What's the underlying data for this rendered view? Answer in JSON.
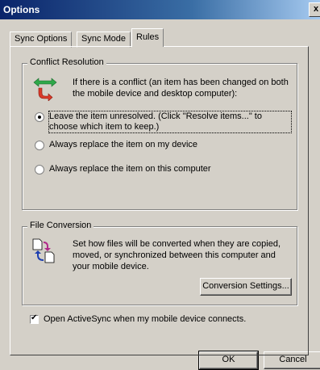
{
  "window": {
    "title": "Options",
    "close_glyph": "x"
  },
  "tabs": [
    {
      "label": "Sync Options",
      "active": false
    },
    {
      "label": "Sync Mode",
      "active": false
    },
    {
      "label": "Rules",
      "active": true
    }
  ],
  "conflict": {
    "legend": "Conflict Resolution",
    "description": "If there is a conflict (an item has been changed on both the mobile device and desktop computer):",
    "icon": "conflict-arrows-icon",
    "options": [
      {
        "label": "Leave the item unresolved. (Click \"Resolve items...\" to choose which item to keep.)",
        "checked": true
      },
      {
        "label": "Always replace the item on my device",
        "checked": false
      },
      {
        "label": "Always replace the item on this computer",
        "checked": false
      }
    ]
  },
  "file_conversion": {
    "legend": "File Conversion",
    "description": "Set how files will be converted when they are copied, moved, or synchronized between this computer and your mobile device.",
    "icon": "file-conversion-icon",
    "button_label": "Conversion Settings..."
  },
  "activesync": {
    "label": "Open ActiveSync when my mobile device connects.",
    "checked": true
  },
  "buttons": {
    "ok": "OK",
    "cancel": "Cancel"
  },
  "colors": {
    "dialog_bg": "#d4d0c8",
    "titlebar": "#0a246a"
  }
}
